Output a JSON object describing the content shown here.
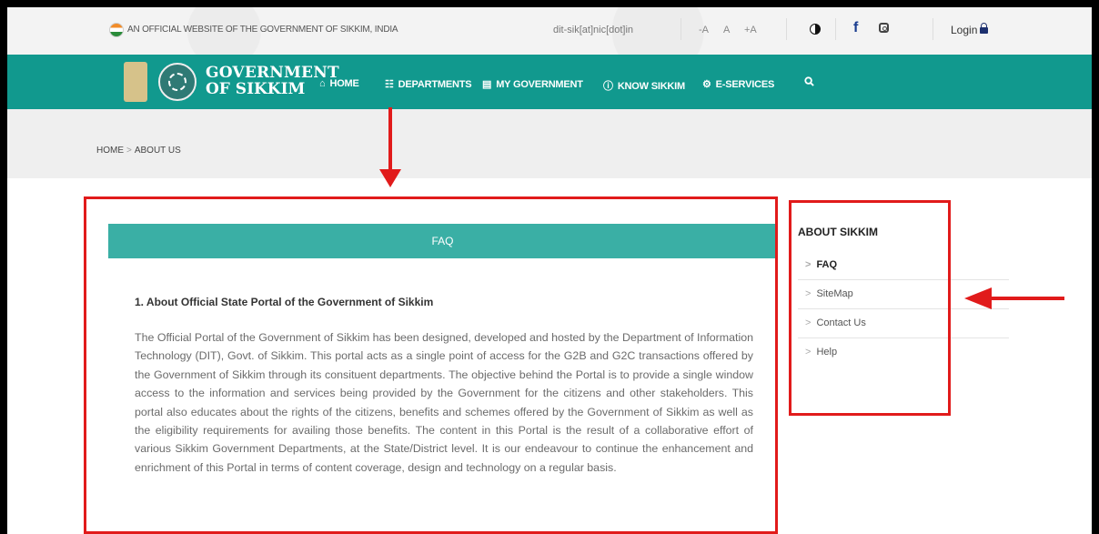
{
  "topbar": {
    "official_text": "AN OFFICIAL WEBSITE OF THE GOVERNMENT OF SIKKIM, INDIA",
    "email": "dit-sik[at]nic[dot]in",
    "font_small": "-A",
    "font_normal": "A",
    "font_large": "+A",
    "login": "Login"
  },
  "nav": {
    "brand_line1": "GOVERNMENT",
    "brand_line2": "OF SIKKIM",
    "items": [
      {
        "label": "HOME",
        "icon": "home-icon"
      },
      {
        "label": "DEPARTMENTS",
        "icon": "sitemap-icon"
      },
      {
        "label": "MY GOVERNMENT",
        "icon": "institution-icon"
      },
      {
        "label": "KNOW SIKKIM",
        "icon": "info-icon"
      },
      {
        "label": "E-SERVICES",
        "icon": "cog-icon"
      }
    ]
  },
  "breadcrumb": {
    "home": "HOME",
    "separator": ">",
    "current": "ABOUT US"
  },
  "faq": {
    "header": "FAQ",
    "question": "1. About Official State Portal of the Government of Sikkim",
    "answer": "The Official Portal of the Government of Sikkim has been designed, developed and hosted by the Department of Information Technology (DIT), Govt. of Sikkim. This portal acts as a single point of access for the G2B and G2C transactions offered by the Government of Sikkim through its consituent departments. The objective behind the Portal is to provide a single window access to the information and services being provided by the Government for the citizens and other stakeholders. This portal also educates about the rights of the citizens, benefits and schemes offered by the Government of Sikkim as well as the eligibility requirements for availing those benefits. The content in this Portal is the result of a collaborative effort of various Sikkim Government Departments, at the State/District level. It is our endeavour to continue the enhancement and enrichment of this Portal in terms of content coverage, design and technology on a regular basis."
  },
  "sidebar": {
    "title": "ABOUT SIKKIM",
    "chevron": ">",
    "items": [
      {
        "label": "FAQ",
        "active": true
      },
      {
        "label": "SiteMap"
      },
      {
        "label": "Contact Us"
      },
      {
        "label": "Help"
      }
    ]
  },
  "colors": {
    "nav_bg": "#11998e",
    "faq_header_bg": "#3aafa5",
    "annotation_red": "#e11b1b"
  }
}
